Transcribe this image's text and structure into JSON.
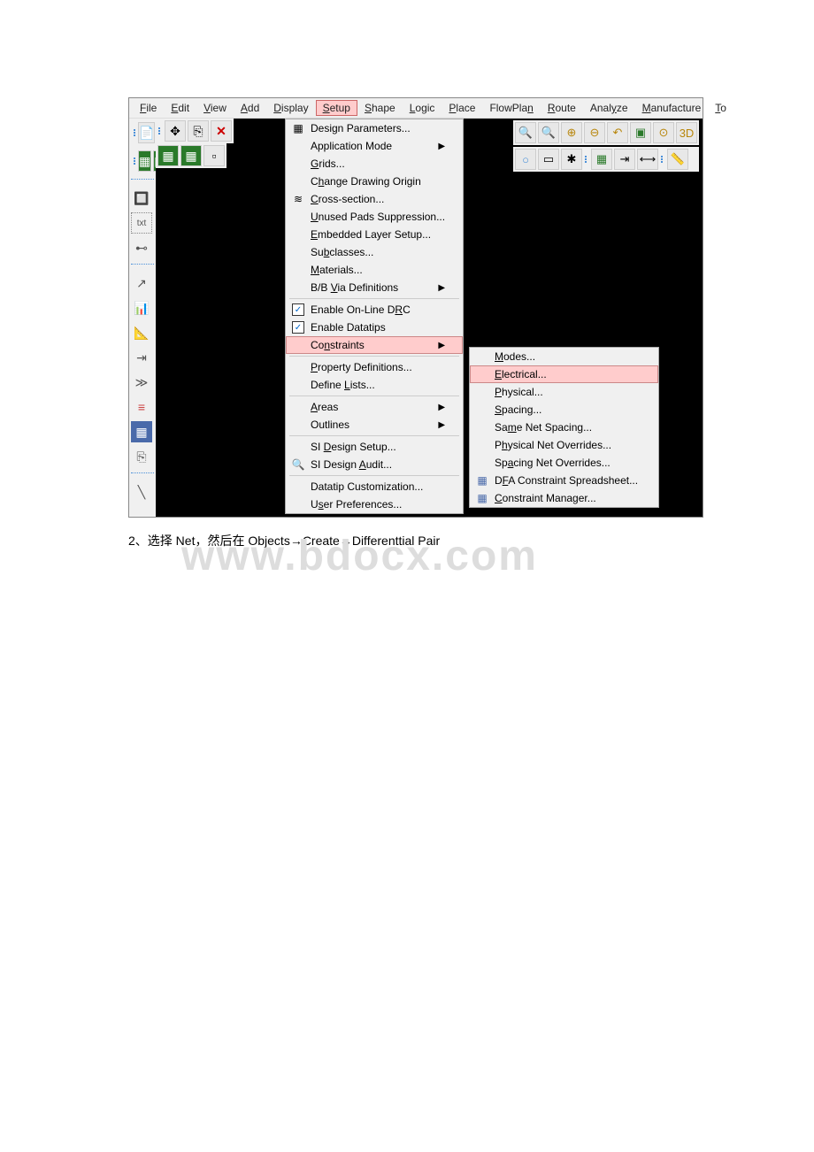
{
  "menubar": {
    "items": [
      {
        "label": "File",
        "accel": "F"
      },
      {
        "label": "Edit",
        "accel": "E"
      },
      {
        "label": "View",
        "accel": "V"
      },
      {
        "label": "Add",
        "accel": "A"
      },
      {
        "label": "Display",
        "accel": "D"
      },
      {
        "label": "Setup",
        "accel": "S"
      },
      {
        "label": "Shape",
        "accel": "S"
      },
      {
        "label": "Logic",
        "accel": "L"
      },
      {
        "label": "Place",
        "accel": "P"
      },
      {
        "label": "FlowPlan",
        "accel": "n"
      },
      {
        "label": "Route",
        "accel": "R"
      },
      {
        "label": "Analyze",
        "accel": "y"
      },
      {
        "label": "Manufacture",
        "accel": "M"
      },
      {
        "label": "Tools",
        "accel": "T"
      }
    ]
  },
  "setup_menu": {
    "items": [
      {
        "label": "Design Parameters...",
        "icon": "grid"
      },
      {
        "label": "Application Mode",
        "arrow": true
      },
      {
        "label": "Grids..."
      },
      {
        "label": "Change Drawing Origin"
      },
      {
        "label": "Cross-section...",
        "icon": "layers"
      },
      {
        "label": "Unused Pads Suppression..."
      },
      {
        "label": "Embedded Layer Setup..."
      },
      {
        "label": "Subclasses..."
      },
      {
        "label": "Materials..."
      },
      {
        "label": "B/B Via Definitions",
        "arrow": true
      },
      {
        "sep": true
      },
      {
        "label": "Enable On-Line DRC",
        "icon": "check"
      },
      {
        "label": "Enable Datatips",
        "icon": "check"
      },
      {
        "label": "Constraints",
        "highlighted": true,
        "arrow": true
      },
      {
        "sep": true
      },
      {
        "label": "Property Definitions..."
      },
      {
        "label": "Define Lists..."
      },
      {
        "sep": true
      },
      {
        "label": "Areas",
        "arrow": true
      },
      {
        "label": "Outlines",
        "arrow": true
      },
      {
        "sep": true
      },
      {
        "label": "SI Design Setup..."
      },
      {
        "label": "SI Design Audit...",
        "icon": "audit"
      },
      {
        "sep": true
      },
      {
        "label": "Datatip Customization..."
      },
      {
        "label": "User Preferences..."
      }
    ]
  },
  "constraints_submenu": {
    "items": [
      {
        "label": "Modes..."
      },
      {
        "label": "Electrical...",
        "highlighted": true
      },
      {
        "label": "Physical..."
      },
      {
        "label": "Spacing..."
      },
      {
        "label": "Same Net Spacing..."
      },
      {
        "label": "Physical Net Overrides..."
      },
      {
        "label": "Spacing Net Overrides..."
      },
      {
        "label": "DFA Constraint Spreadsheet...",
        "icon": "sheet"
      },
      {
        "label": "Constraint Manager...",
        "icon": "sheet"
      }
    ]
  },
  "caption": "2、选择 Net，然后在 Objects→Create→Differenttial Pair",
  "watermark": "www.bdocx.com"
}
